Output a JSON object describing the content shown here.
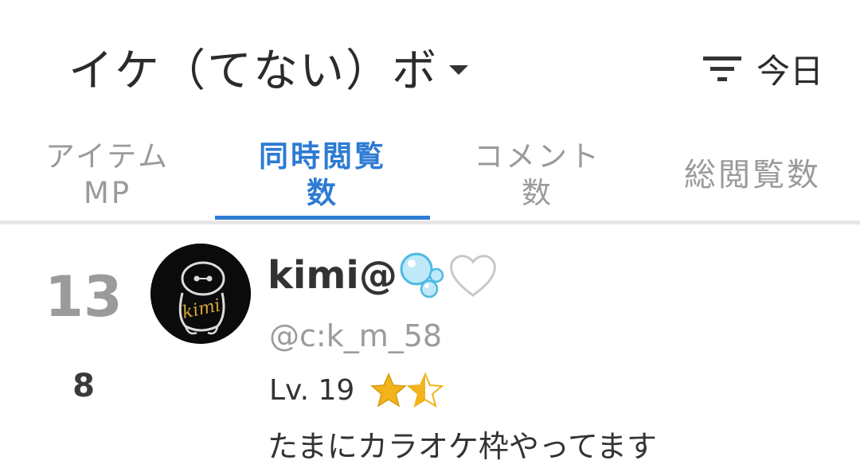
{
  "header": {
    "title": "イケ（てない）ボ",
    "filter_label": "今日"
  },
  "tabs": [
    {
      "label": "アイテム\nMP",
      "active": false
    },
    {
      "label": "同時閲覧\n数",
      "active": true
    },
    {
      "label": "コメント\n数",
      "active": false
    },
    {
      "label": "総閲覧数",
      "active": false
    }
  ],
  "row": {
    "rank": "13",
    "viewers": "8",
    "name": "kimi@",
    "avatar_text": "kimi",
    "handle": "@c:k_m_58",
    "level": "Lv. 19",
    "rating_stars": 1.5,
    "description": "たまにカラオケ枠やってます"
  },
  "colors": {
    "accent": "#2d7bd3",
    "star": "#f2b31b",
    "muted": "#9b9b9b"
  },
  "icons": [
    "dropdown-caret-icon",
    "filter-icon",
    "bubbles-emoji-icon",
    "white-heart-icon",
    "star-full-icon",
    "star-half-icon"
  ]
}
